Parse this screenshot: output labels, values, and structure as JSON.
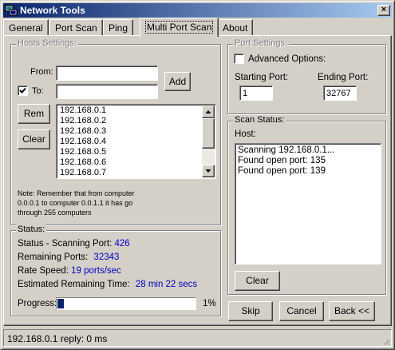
{
  "window": {
    "title": "Network Tools",
    "close_label": "×"
  },
  "tabs": [
    {
      "label": "General",
      "active": false
    },
    {
      "label": "Port Scan",
      "active": false
    },
    {
      "label": "Ping",
      "active": false
    },
    {
      "label": "Multi Port Scan",
      "active": true
    },
    {
      "label": "About",
      "active": false
    }
  ],
  "hosts_settings": {
    "title": "Hosts Settings:",
    "from_label": "From:",
    "from_value": "",
    "to_checked": true,
    "to_label": "To:",
    "to_value": "",
    "add_label": "Add",
    "rem_label": "Rem",
    "clear_label": "Clear",
    "hosts": [
      "192.168.0.1",
      "192.168.0.2",
      "192.168.0.3",
      "192.168.0.4",
      "192.168.0.5",
      "192.168.0.6",
      "192.168.0.7"
    ],
    "note_lines": [
      "Note: Remember that from computer",
      "0.0.0.1 to computer 0.0.1.1 it has go",
      "through 255 computers"
    ]
  },
  "status": {
    "title": "Status:",
    "scanning_port_label": "Status - Scanning Port:",
    "scanning_port_value": "426",
    "remaining_ports_label": "Remaining Ports:",
    "remaining_ports_value": "32343",
    "rate_speed_label": "Rate Speed:",
    "rate_speed_value": "19 ports/sec",
    "remaining_time_label": "Estimated Remaining Time:",
    "remaining_time_value": "28 min 22 secs",
    "progress_label": "Progress:",
    "progress_text": "1%",
    "progress_fraction": 0.01
  },
  "port_settings": {
    "title": "Port Settings:",
    "advanced_label": "Advanced Options:",
    "advanced_checked": false,
    "starting_label": "Starting Port:",
    "starting_value": "1",
    "ending_label": "Ending Port:",
    "ending_value": "32767"
  },
  "scan_status": {
    "title": "Scan Status:",
    "host_label": "Host:",
    "log": [
      "Scanning 192.168.0.1...",
      "Found open port: 135",
      "Found open port: 139"
    ],
    "clear_label": "Clear"
  },
  "actions": {
    "skip_label": "Skip",
    "cancel_label": "Cancel",
    "back_label": "Back <<"
  },
  "statusbar": {
    "text": "192.168.0.1 reply: 0 ms"
  },
  "colors": {
    "title_start": "#0a246a",
    "title_end": "#a6caf0",
    "value_blue": "#0000c0",
    "progress_fill": "#0a246a"
  },
  "icons": {
    "app": "network-computer-icon",
    "close": "close-icon"
  }
}
